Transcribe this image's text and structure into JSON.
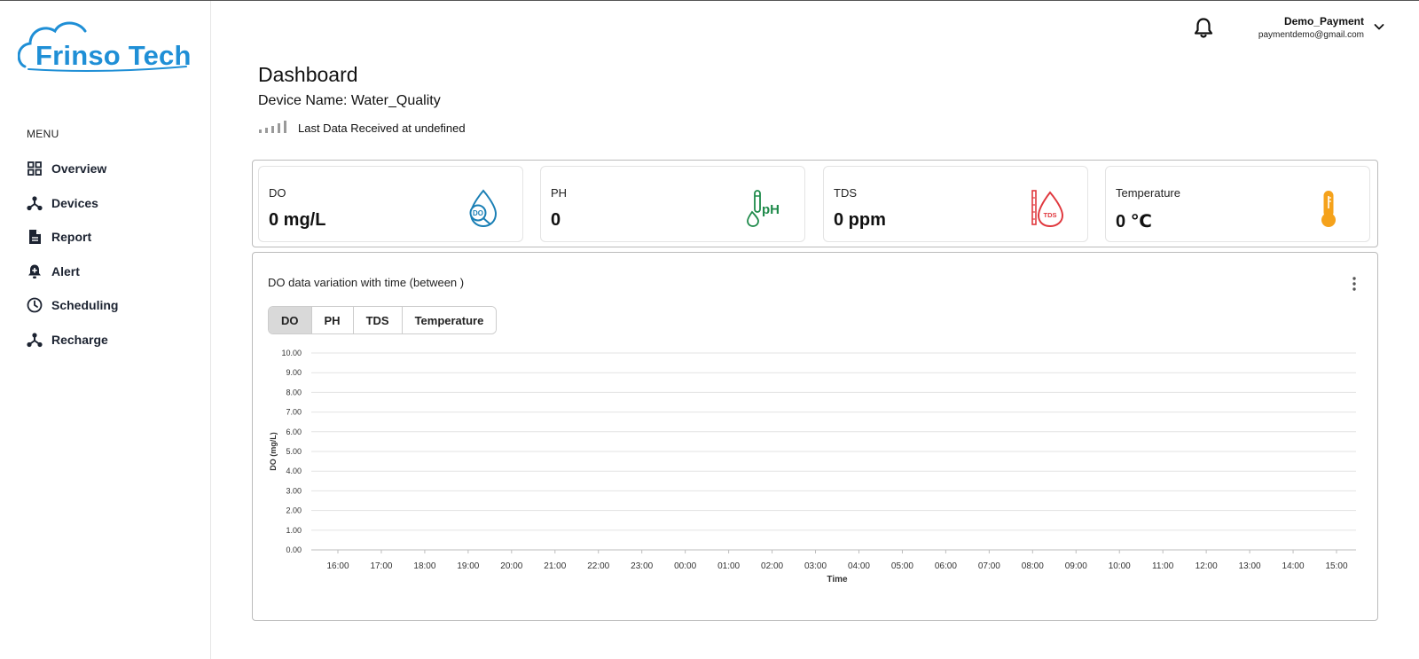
{
  "brand": {
    "name": "Frinso Tech",
    "color": "#1f8fd6"
  },
  "sidebar": {
    "menu_heading": "MENU",
    "items": [
      {
        "label": "Overview",
        "icon": "grid-icon"
      },
      {
        "label": "Devices",
        "icon": "hub-icon"
      },
      {
        "label": "Report",
        "icon": "document-icon"
      },
      {
        "label": "Alert",
        "icon": "bell-plus-icon"
      },
      {
        "label": "Scheduling",
        "icon": "clock-icon"
      },
      {
        "label": "Recharge",
        "icon": "hub-icon"
      }
    ]
  },
  "header": {
    "user_name": "Demo_Payment",
    "user_email": "paymentdemo@gmail.com"
  },
  "page": {
    "title": "Dashboard",
    "device_name_label": "Device Name: Water_Quality",
    "last_data": "Last Data Received at undefined"
  },
  "cards": [
    {
      "label": "DO",
      "value": "0 mg/L",
      "icon": "do-drop-icon",
      "color": "#1a7fb5"
    },
    {
      "label": "PH",
      "value": "0",
      "icon": "ph-tube-icon",
      "color": "#1e8a4a"
    },
    {
      "label": "TDS",
      "value": "0 ppm",
      "icon": "tds-drop-icon",
      "color": "#e0383e"
    },
    {
      "label": "Temperature",
      "value": "0 ℃",
      "icon": "thermometer-icon",
      "color": "#f5a21b"
    }
  ],
  "chart_panel": {
    "title": "DO data variation with time (between )",
    "tabs": [
      "DO",
      "PH",
      "TDS",
      "Temperature"
    ],
    "active_tab": "DO"
  },
  "chart_data": {
    "type": "line",
    "title": "",
    "xlabel": "Time",
    "ylabel": "DO (mg/L)",
    "ylim": [
      0,
      10
    ],
    "y_ticks": [
      "0.00",
      "1.00",
      "2.00",
      "3.00",
      "4.00",
      "5.00",
      "6.00",
      "7.00",
      "8.00",
      "9.00",
      "10.00"
    ],
    "x_ticks": [
      "16:00",
      "17:00",
      "18:00",
      "19:00",
      "20:00",
      "21:00",
      "22:00",
      "23:00",
      "00:00",
      "01:00",
      "02:00",
      "03:00",
      "04:00",
      "05:00",
      "06:00",
      "07:00",
      "08:00",
      "09:00",
      "10:00",
      "11:00",
      "12:00",
      "13:00",
      "14:00",
      "15:00"
    ],
    "series": [],
    "grid": true
  }
}
